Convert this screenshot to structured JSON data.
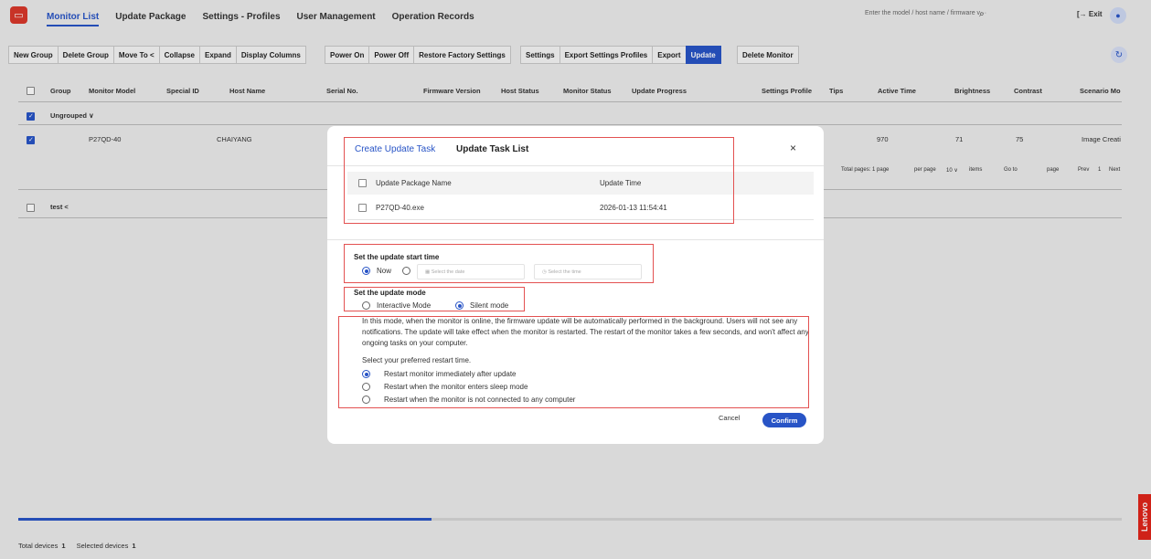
{
  "nav": {
    "tabs": [
      {
        "label": "Monitor List"
      },
      {
        "label": "Update Package"
      },
      {
        "label": "Settings - Profiles"
      },
      {
        "label": "User Management"
      },
      {
        "label": "Operation Records"
      }
    ],
    "search_placeholder": "Enter the model / host name / firmware v···",
    "exit_label": "Exit"
  },
  "toolbar": {
    "group1": [
      "New Group",
      "Delete Group",
      "Move To <",
      "Collapse",
      "Expand",
      "Display Columns"
    ],
    "group2": [
      "Power On",
      "Power Off",
      "Restore Factory Settings"
    ],
    "group3": [
      "Settings",
      "Export Settings Profiles",
      "Export",
      "Update"
    ],
    "group4": [
      "Delete Monitor"
    ]
  },
  "table": {
    "columns": [
      "Group",
      "Monitor Model",
      "Special ID",
      "Host Name",
      "Serial No.",
      "Firmware Version",
      "Host Status",
      "Monitor Status",
      "Update Progress",
      "Settings Profile",
      "Tips",
      "Active Time",
      "Brightness",
      "Contrast",
      "Scenario Mo"
    ],
    "groups": [
      {
        "name": "Ungrouped ∨"
      },
      {
        "name": "test <"
      }
    ],
    "row": {
      "model": "P27QD-40",
      "host": "CHAIYANG",
      "active_time": "970",
      "brightness": "71",
      "contrast": "75",
      "scenario": "Image Creati"
    },
    "pagination": {
      "total_pages": "Total pages: 1 page",
      "per_page": "per page",
      "size": "10",
      "items": "items",
      "goto": "Go to",
      "page": "page",
      "prev": "Prev",
      "current": "1",
      "next": "Next"
    }
  },
  "footer": {
    "total_label": "Total devices",
    "total": "1",
    "selected_label": "Selected devices",
    "selected": "1"
  },
  "brand": "Lenovo",
  "modal": {
    "tabs": [
      "Create Update Task",
      "Update Task List"
    ],
    "close": "×",
    "package_table": {
      "headers": [
        "Update Package Name",
        "Update Time"
      ],
      "rows": [
        {
          "name": "P27QD-40.exe",
          "time": "2026-01-13 11:54:41"
        }
      ]
    },
    "start_time": {
      "title": "Set the update start time",
      "now_label": "Now",
      "date_placeholder": "Select the date",
      "time_placeholder": "Select the time"
    },
    "mode": {
      "title": "Set the update mode",
      "options": [
        "Interactive Mode",
        "Silent mode"
      ],
      "selected": "Silent mode"
    },
    "silent_description": "In this mode, when the monitor is online, the firmware update will be automatically performed in the background. Users will not see any notifications. The update will take effect when the monitor is restarted. The restart of the monitor takes a few seconds, and won't affect any ongoing tasks on your computer.",
    "restart": {
      "prompt": "Select your preferred restart time.",
      "options": [
        "Restart monitor immediately after update",
        "Restart when the monitor enters sleep mode",
        "Restart when the monitor is not connected to any computer"
      ],
      "selected": "Restart monitor immediately after update"
    },
    "cancel_label": "Cancel",
    "confirm_label": "Confirm"
  },
  "colors": {
    "accent": "#2854c6",
    "highlight_box": "#e35151",
    "brand": "#e1251b"
  }
}
